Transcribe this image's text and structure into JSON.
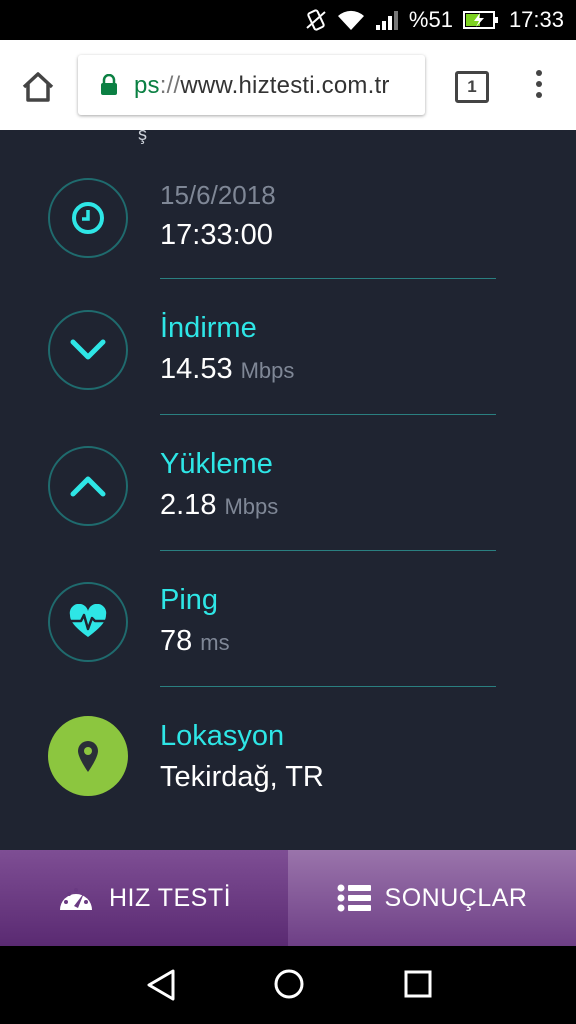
{
  "status_bar": {
    "battery": "%51",
    "time": "17:33"
  },
  "browser": {
    "url_scheme_tail": "ps",
    "url_separator": "://",
    "url_host": "www.hiztesti.com.tr",
    "tab_count": "1"
  },
  "content": {
    "partial_glyph": "ş",
    "results": [
      {
        "label": "15/6/2018",
        "value": "17:33:00",
        "unit": "",
        "icon": "clock-icon"
      },
      {
        "label": "İndirme",
        "value": "14.53",
        "unit": "Mbps",
        "icon": "chevron-down-icon"
      },
      {
        "label": "Yükleme",
        "value": "2.18",
        "unit": "Mbps",
        "icon": "chevron-up-icon"
      },
      {
        "label": "Ping",
        "value": "78",
        "unit": "ms",
        "icon": "heart-pulse-icon"
      },
      {
        "label": "Lokasyon",
        "value": "Tekirdağ, TR",
        "unit": "",
        "icon": "location-pin-icon"
      }
    ]
  },
  "bottom_tabs": {
    "speed_test": "HIZ TESTİ",
    "results": "SONUÇLAR"
  },
  "colors": {
    "accent_cyan": "#2ee6e6",
    "background": "#1f2431",
    "location_green": "#8cc63f",
    "tab_purple": "#6e3f86"
  }
}
